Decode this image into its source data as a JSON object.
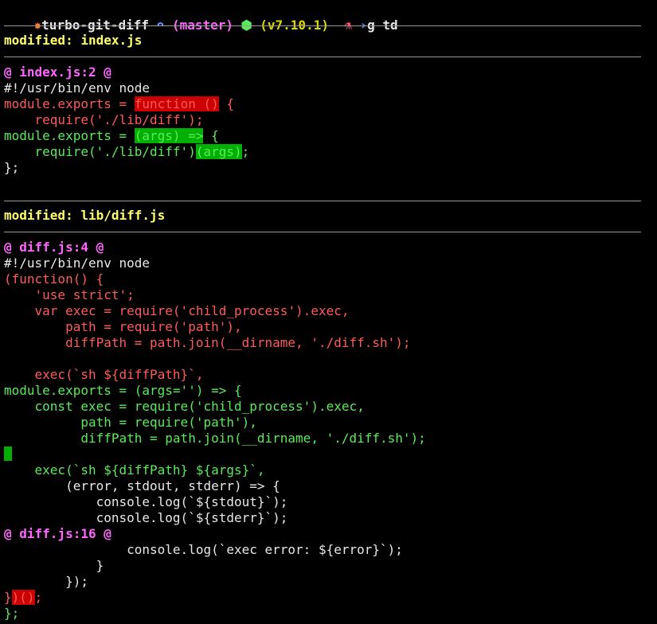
{
  "prompt": {
    "glyph": "✸",
    "repo": "turbo-git-diff",
    "branch_glyph": "ᴖ",
    "branch": "(master)",
    "node_glyph": "⬢",
    "version": "(v7.10.1)",
    "flask_glyph": "⚗",
    "arrow_glyph": "›",
    "command": "g td"
  },
  "colors": {
    "removed": "#ff5b5b",
    "added": "#5bea5b",
    "removed_highlight": "#cc0000",
    "added_highlight": "#00b000",
    "file_header": "#ffff66",
    "hunk_header": "#ff66ff"
  },
  "files": [
    {
      "header": "modified: index.js",
      "hunk": "@ index.js:2 @",
      "lines": {
        "l1": "#!/usr/bin/env node",
        "l2a": "module.exports = ",
        "l2b": "function ()",
        "l2c": " {",
        "l3": "    require('./lib/diff');",
        "l4a": "module.exports = ",
        "l4b": "(args) =>",
        "l4c": " {",
        "l5a": "    require('./lib/diff')",
        "l5b": "(args)",
        "l5c": ";",
        "l6": "};"
      }
    },
    {
      "header": "modified: lib/diff.js",
      "hunk": "@ diff.js:4 @",
      "hunk2": "@ diff.js:16 @",
      "lines": {
        "l1": "#!/usr/bin/env node",
        "l2": "(function() {",
        "l3": "    'use strict';",
        "l4": "    var exec = require('child_process').exec,",
        "l5": "        path = require('path'),",
        "l6": "        diffPath = path.join(__dirname, './diff.sh');",
        "l7": "    exec(`sh ${diffPath}`,",
        "l8": "module.exports = (args='') => {",
        "l9": "    const exec = require('child_process').exec,",
        "l10": "          path = require('path'),",
        "l11": "          diffPath = path.join(__dirname, './diff.sh');",
        "l12": "    exec(`sh ${diffPath} ${args}`,",
        "l13": "        (error, stdout, stderr) => {",
        "l14": "            console.log(`${stdout}`);",
        "l15": "            console.log(`${stderr}`);",
        "l16": "                console.log(`exec error: ${error}`);",
        "l17": "            }",
        "l18": "        });",
        "l19a": "}",
        "l19b": ")()",
        "l19c": ";",
        "l20": "};"
      }
    }
  ]
}
